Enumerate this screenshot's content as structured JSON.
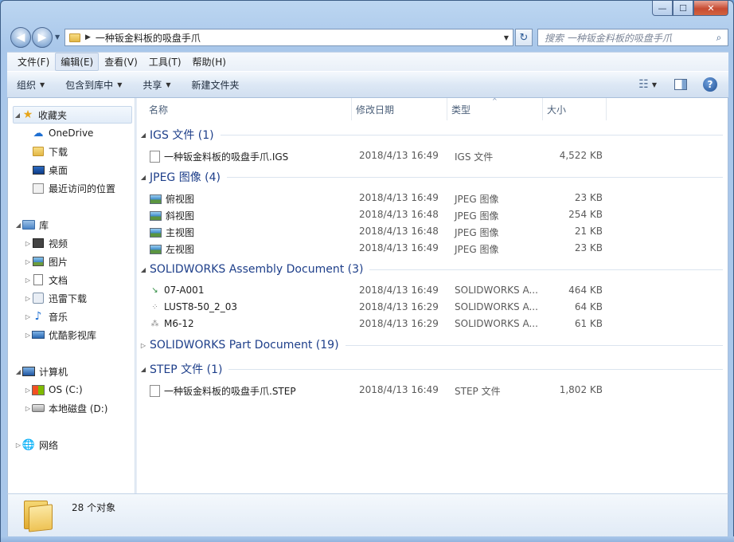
{
  "window": {
    "minimize_glyph": "—",
    "maximize_glyph": "☐",
    "close_glyph": "✕"
  },
  "address_bar": {
    "path": "一种钣金料板的吸盘手爪",
    "separator": "▶",
    "dropdown": "▼",
    "refresh_glyph": "↻"
  },
  "search": {
    "placeholder": "搜索 一种钣金料板的吸盘手爪",
    "icon": "search-icon"
  },
  "menu": {
    "items": [
      "文件(F)",
      "编辑(E)",
      "查看(V)",
      "工具(T)",
      "帮助(H)"
    ]
  },
  "toolbar": {
    "organize": "组织",
    "include_library": "包含到库中",
    "share": "共享",
    "new_folder": "新建文件夹",
    "help": "?"
  },
  "nav_pane": {
    "favorites": {
      "label": "收藏夹",
      "items": [
        "OneDrive",
        "下载",
        "桌面",
        "最近访问的位置"
      ]
    },
    "libraries": {
      "label": "库",
      "items": [
        "视频",
        "图片",
        "文档",
        "迅雷下载",
        "音乐",
        "优酷影视库"
      ]
    },
    "computer": {
      "label": "计算机",
      "items": [
        "OS (C:)",
        "本地磁盘 (D:)"
      ]
    },
    "network": {
      "label": "网络"
    }
  },
  "columns": {
    "name": "名称",
    "date": "修改日期",
    "type": "类型",
    "size": "大小",
    "sort_glyph": "^"
  },
  "groups": [
    {
      "label": "IGS 文件 (1)",
      "expanded": true,
      "files": [
        {
          "name": "一种钣金料板的吸盘手爪.IGS",
          "date": "2018/4/13 16:49",
          "type": "IGS 文件",
          "size": "4,522 KB"
        }
      ]
    },
    {
      "label": "JPEG 图像 (4)",
      "expanded": true,
      "files": [
        {
          "name": "俯视图",
          "date": "2018/4/13 16:49",
          "type": "JPEG 图像",
          "size": "23 KB"
        },
        {
          "name": "斜视图",
          "date": "2018/4/13 16:48",
          "type": "JPEG 图像",
          "size": "254 KB"
        },
        {
          "name": "主视图",
          "date": "2018/4/13 16:48",
          "type": "JPEG 图像",
          "size": "21 KB"
        },
        {
          "name": "左视图",
          "date": "2018/4/13 16:49",
          "type": "JPEG 图像",
          "size": "23 KB"
        }
      ]
    },
    {
      "label": "SOLIDWORKS Assembly Document (3)",
      "expanded": true,
      "files": [
        {
          "name": "07-A001",
          "date": "2018/4/13 16:49",
          "type": "SOLIDWORKS A...",
          "size": "464 KB"
        },
        {
          "name": "LUST8-50_2_03",
          "date": "2018/4/13 16:29",
          "type": "SOLIDWORKS A...",
          "size": "64 KB"
        },
        {
          "name": "M6-12",
          "date": "2018/4/13 16:29",
          "type": "SOLIDWORKS A...",
          "size": "61 KB"
        }
      ]
    },
    {
      "label": "SOLIDWORKS Part Document (19)",
      "expanded": false,
      "files": []
    },
    {
      "label": "STEP 文件 (1)",
      "expanded": true,
      "files": [
        {
          "name": "一种钣金料板的吸盘手爪.STEP",
          "date": "2018/4/13 16:49",
          "type": "STEP 文件",
          "size": "1,802 KB"
        }
      ]
    }
  ],
  "status": {
    "count": "28 个对象"
  },
  "colors": {
    "group_header": "#1e3f8a",
    "frame": "#a9c7ea"
  }
}
